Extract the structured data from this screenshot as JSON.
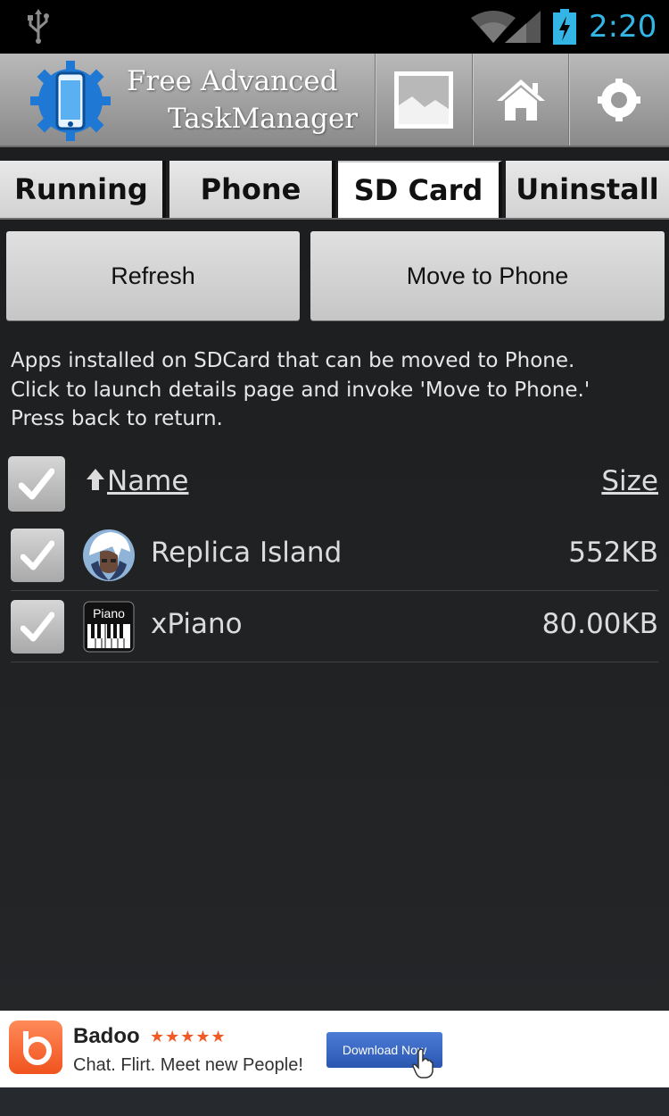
{
  "status_bar": {
    "time": "2:20",
    "icons": [
      "usb-icon",
      "wifi-icon",
      "signal-icon",
      "battery-charging-icon"
    ],
    "accent": "#33b5e5"
  },
  "header": {
    "title_line1": "Free Advanced",
    "title_line2": "TaskManager",
    "buttons": [
      "wallpaper-icon",
      "home-icon",
      "settings-icon"
    ]
  },
  "tabs": [
    {
      "label": "Running",
      "active": false
    },
    {
      "label": "Phone",
      "active": false
    },
    {
      "label": "SD Card",
      "active": true
    },
    {
      "label": "Uninstall",
      "active": false
    }
  ],
  "actions": {
    "refresh": "Refresh",
    "move": "Move to Phone"
  },
  "info": {
    "line1": "Apps installed on SDCard that can be moved to Phone.",
    "line2": "Click to launch details page and invoke 'Move to Phone.'",
    "line3": "Press back to return."
  },
  "list": {
    "select_all_checked": true,
    "sort_icon": "up-arrow-icon",
    "col_name": "Name",
    "col_size": "Size",
    "rows": [
      {
        "name": "Replica Island",
        "size": "552KB",
        "checked": true,
        "icon": "replica-island-icon"
      },
      {
        "name": "xPiano",
        "size": "80.00KB",
        "checked": true,
        "icon": "xpiano-icon",
        "icon_text": "Piano"
      }
    ]
  },
  "ad": {
    "brand": "Badoo",
    "stars": "★★★★★",
    "tagline": "Chat. Flirt. Meet new People!",
    "cta": "Download Now",
    "brand_color": "#f15a24"
  }
}
